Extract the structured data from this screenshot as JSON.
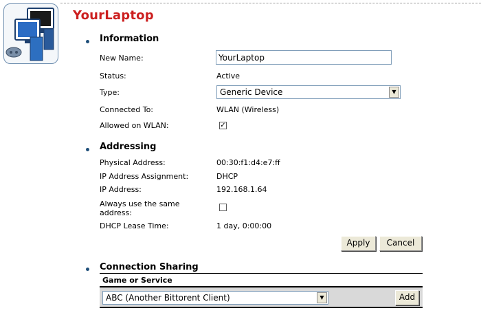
{
  "device": {
    "title": "YourLaptop",
    "icon": "network-computers-icon"
  },
  "information": {
    "heading": "Information",
    "new_name_label": "New Name:",
    "new_name_value": "YourLaptop",
    "status_label": "Status:",
    "status_value": "Active",
    "type_label": "Type:",
    "type_value": "Generic Device",
    "connected_label": "Connected To:",
    "connected_value": "WLAN (Wireless)",
    "allowed_label": "Allowed on WLAN:",
    "allowed_checked": true
  },
  "addressing": {
    "heading": "Addressing",
    "physical_label": "Physical Address:",
    "physical_value": "00:30:f1:d4:e7:ff",
    "assignment_label": "IP Address Assignment:",
    "assignment_value": "DHCP",
    "ip_label": "IP Address:",
    "ip_value": "192.168.1.64",
    "same_address_label_1": "Always use the same",
    "same_address_label_2": "address:",
    "same_address_checked": false,
    "lease_label": "DHCP Lease Time:",
    "lease_value": "1 day, 0:00:00"
  },
  "buttons": {
    "apply": "Apply",
    "cancel": "Cancel",
    "add": "Add"
  },
  "sharing": {
    "heading": "Connection Sharing",
    "column_header": "Game or Service",
    "selected_service": "ABC (Another Bittorent Client)"
  },
  "colors": {
    "title": "#cc1f1f",
    "bullet": "#1f4f7a",
    "button_face": "#ece9d8",
    "table_row": "#d9d9d9"
  }
}
